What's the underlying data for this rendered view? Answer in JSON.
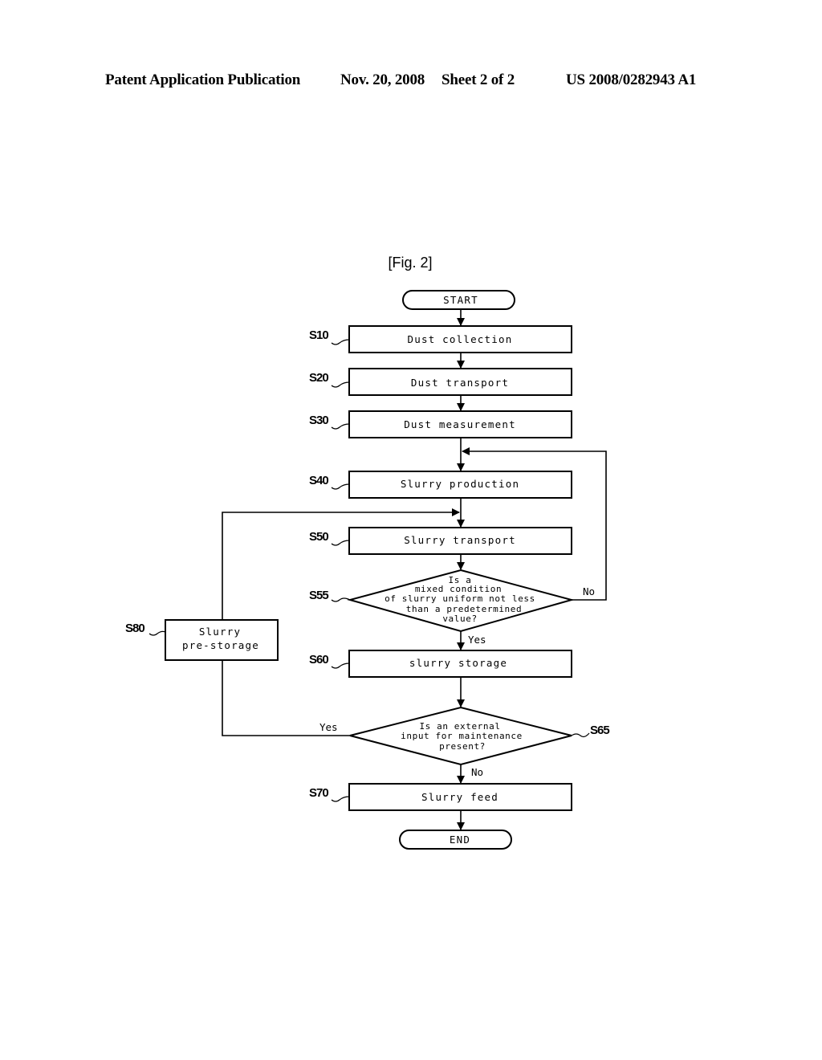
{
  "header": {
    "publication": "Patent Application Publication",
    "date": "Nov. 20, 2008",
    "sheet": "Sheet 2 of 2",
    "number": "US 2008/0282943 A1"
  },
  "figure": {
    "title": "[Fig. 2]",
    "terminals": {
      "start": "START",
      "end": "END"
    },
    "steps": {
      "s10": {
        "label": "S10",
        "text": "Dust collection"
      },
      "s20": {
        "label": "S20",
        "text": "Dust transport"
      },
      "s30": {
        "label": "S30",
        "text": "Dust measurement"
      },
      "s40": {
        "label": "S40",
        "text": "Slurry production"
      },
      "s50": {
        "label": "S50",
        "text": "Slurry transport"
      },
      "s60": {
        "label": "S60",
        "text": "slurry storage"
      },
      "s70": {
        "label": "S70",
        "text": "Slurry feed"
      },
      "s80": {
        "label": "S80",
        "lines": [
          "Slurry",
          "pre-storage"
        ]
      }
    },
    "decisions": {
      "s55": {
        "label": "S55",
        "lines": [
          "Is a",
          "mixed condition",
          "of slurry uniform not less",
          "than a predetermined",
          "value?"
        ],
        "yes": "Yes",
        "no": "No"
      },
      "s65": {
        "label": "S65",
        "lines": [
          "Is an external",
          "input for maintenance",
          "present?"
        ],
        "yes": "Yes",
        "no": "No"
      }
    }
  }
}
